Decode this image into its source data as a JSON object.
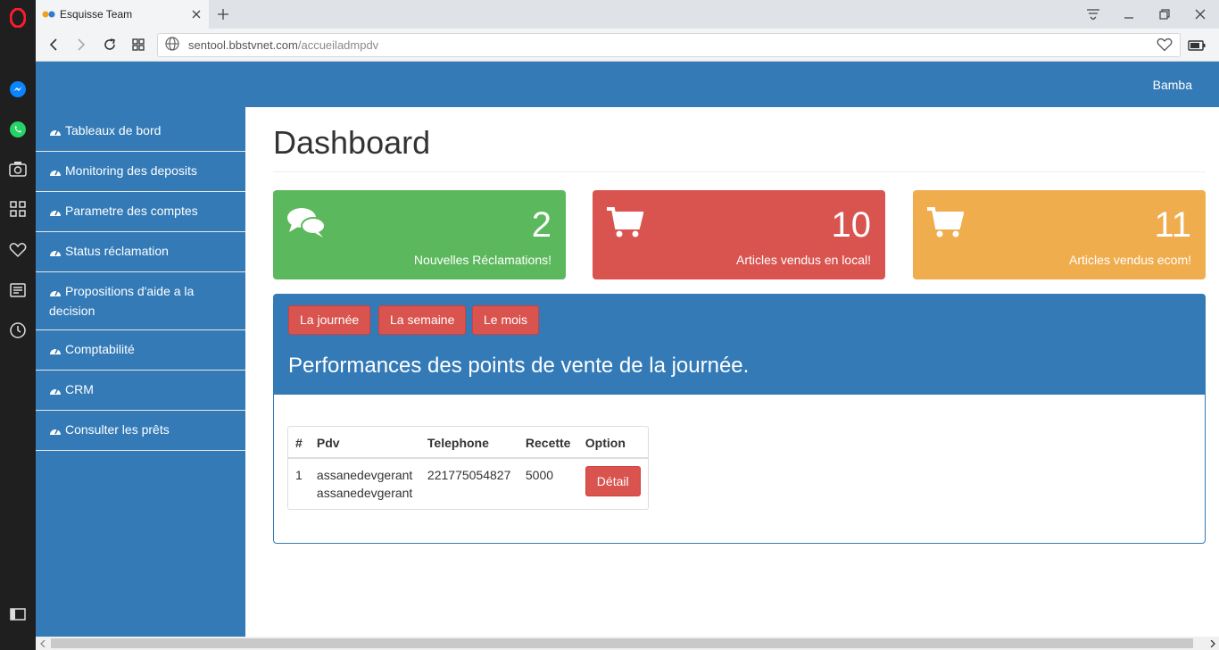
{
  "browser": {
    "tab_title": "Esquisse Team",
    "url_host": "sentool.bbstvnet.com",
    "url_path": "/accueiladmpdv"
  },
  "header": {
    "user": "Bamba"
  },
  "sidebar": {
    "items": [
      {
        "label": "Tableaux de bord"
      },
      {
        "label": "Monitoring des deposits"
      },
      {
        "label": "Parametre des comptes"
      },
      {
        "label": "Status réclamation"
      },
      {
        "label": "Propositions d'aide a la decision"
      },
      {
        "label": "Comptabilité"
      },
      {
        "label": "CRM"
      },
      {
        "label": "Consulter les prêts"
      }
    ]
  },
  "main": {
    "title": "Dashboard",
    "stats": [
      {
        "value": "2",
        "label": "Nouvelles Réclamations!",
        "color": "#5cb85c",
        "icon": "comments-icon"
      },
      {
        "value": "10",
        "label": "Articles vendus en local!",
        "color": "#d9534f",
        "icon": "cart-icon"
      },
      {
        "value": "11",
        "label": "Articles vendus ecom!",
        "color": "#f0ad4e",
        "icon": "cart-icon"
      }
    ],
    "performance": {
      "buttons": [
        "La journée",
        "La semaine",
        "Le mois"
      ],
      "title": "Performances des points de vente de la journée.",
      "columns": [
        "#",
        "Pdv",
        "Telephone",
        "Recette",
        "Option"
      ],
      "rows": [
        {
          "num": "1",
          "pdv_line1": "assanedevgerant",
          "pdv_line2": "assanedevgerant",
          "telephone": "221775054827",
          "recette": "5000",
          "option": "Détail"
        }
      ]
    }
  },
  "colors": {
    "primary": "#337ab7",
    "success": "#5cb85c",
    "danger": "#d9534f",
    "warning": "#f0ad4e"
  }
}
